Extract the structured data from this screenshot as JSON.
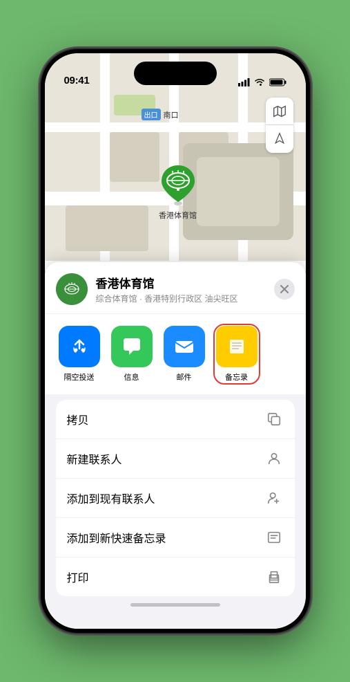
{
  "status_bar": {
    "time": "09:41",
    "location_icon": "◀",
    "signal_bars": "signal",
    "wifi": "wifi",
    "battery": "battery"
  },
  "map": {
    "poi_tag": "出口",
    "poi_name": "南口",
    "pin_label": "香港体育馆",
    "map_layer_icon": "🗺",
    "location_icon": "⊳"
  },
  "bottom_sheet": {
    "venue_name": "香港体育馆",
    "venue_subtitle": "综合体育馆 · 香港特别行政区 油尖旺区",
    "close_label": "×",
    "share_items": [
      {
        "id": "airdrop",
        "label": "隔空投送",
        "bg": "#007aff"
      },
      {
        "id": "message",
        "label": "信息",
        "bg": "#34c759"
      },
      {
        "id": "mail",
        "label": "邮件",
        "bg": "#007aff"
      },
      {
        "id": "notes",
        "label": "备忘录",
        "bg": "#ffcc00",
        "highlighted": true
      }
    ],
    "actions": [
      {
        "label": "拷贝",
        "icon": "copy"
      },
      {
        "label": "新建联系人",
        "icon": "person"
      },
      {
        "label": "添加到现有联系人",
        "icon": "person-add"
      },
      {
        "label": "添加到新快速备忘录",
        "icon": "memo"
      },
      {
        "label": "打印",
        "icon": "print"
      }
    ]
  }
}
